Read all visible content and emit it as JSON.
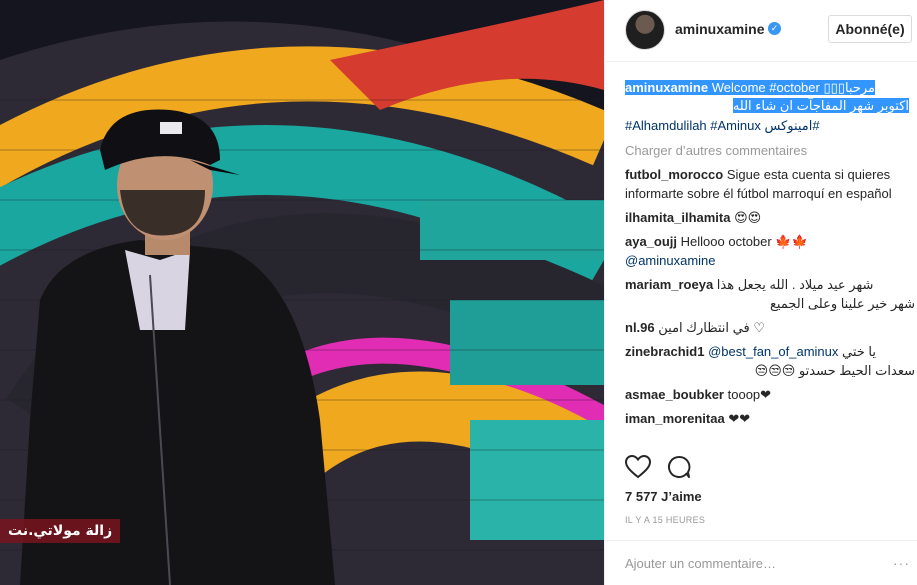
{
  "post": {
    "watermark": "زالة مولاتي.نت"
  },
  "header": {
    "username": "aminuxamine",
    "verified_mark": "✓",
    "follow_label": "Abonné(e)"
  },
  "caption": {
    "username": "aminuxamine",
    "line1_text": " Welcome #october ",
    "line1_boxes": "▯▯▯",
    "line1_arabic": "مرحبا",
    "line2": "اكتوبر شهر المفاجآت ان شاء الله",
    "line3_tags": "#Alhamdulilah #Aminux",
    "line3_arabic": "امينوكس#"
  },
  "load_more": "Charger d’autres commentaires",
  "comments": [
    {
      "user": "futbol_morocco",
      "text": "Sigue esta cuenta si quieres informarte sobre él fútbol marroquí en español"
    },
    {
      "user": "ilhamita_ilhamita",
      "text": "😍😍"
    },
    {
      "user": "aya_oujj",
      "text": "Hellooo october 🍁🍁",
      "mention": "@aminuxamine"
    },
    {
      "user": "mariam_roeya",
      "text": "شهر عيد ميلاد . الله يجعل هذا",
      "text2": "شهر خير علينا وعلى الجميع"
    },
    {
      "user": "nl.96",
      "text": "في انتظارك امين ♡"
    },
    {
      "user": "zinebrachid1",
      "mention": "@best_fan_of_aminux",
      "text": "يا ختي",
      "text2": "سعدات الحيط حسدتو 😒😒😒"
    },
    {
      "user": "asmae_boubker",
      "text": "tooop❤"
    },
    {
      "user": "iman_morenitaa",
      "text": "❤❤"
    }
  ],
  "likes": "7 577 J’aime",
  "time": "IL Y A 15 HEURES",
  "add_comment": {
    "placeholder": "Ajouter un commentaire…",
    "more": "···"
  },
  "icons": {
    "like": "heart-icon",
    "comment": "comment-icon"
  }
}
